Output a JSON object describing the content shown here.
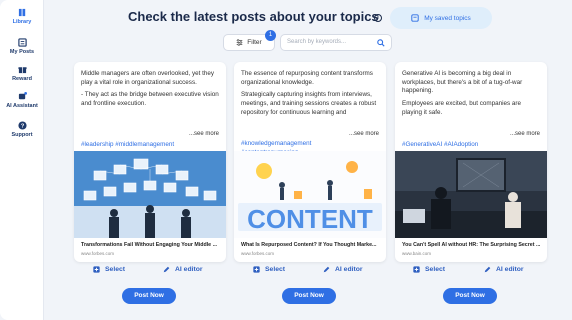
{
  "sidebar": {
    "items": [
      {
        "label": "Library",
        "icon": "library-icon",
        "active": true
      },
      {
        "label": "My Posts",
        "icon": "posts-icon"
      },
      {
        "label": "Reward",
        "icon": "reward-icon"
      },
      {
        "label": "AI Assistant",
        "icon": "ai-assistant-icon"
      },
      {
        "label": "Support",
        "icon": "support-icon"
      }
    ]
  },
  "header": {
    "title": "Check the latest posts about your topics",
    "saved_topics_label": "My saved topics",
    "filter_label": "Filter",
    "filter_count": "1",
    "search_placeholder": "Search by keywords..."
  },
  "cards": [
    {
      "paragraphs": [
        "Middle managers are often overlooked, yet they play a vital role in organizational success.",
        "- They act as the bridge between executive vision and frontline execution."
      ],
      "see_more": "...see more",
      "tags": "#leadership #middlemanagement",
      "link_title": "Transformations Fail Without Engaging Your Middle ...",
      "domain": "www.forbes.com",
      "select_label": "Select",
      "editor_label": "AI editor",
      "post_label": "Post Now"
    },
    {
      "paragraphs": [
        "The essence of repurposing content transforms organizational knowledge.",
        "Strategically capturing insights from interviews, meetings, and training sessions creates a robust repository for continuous learning and"
      ],
      "see_more": "...see more",
      "tags": "#knowledgemanagement\n#contentrepurposing",
      "link_title": "What Is Repurposed Content? If You Thought Marke...",
      "domain": "www.forbes.com",
      "select_label": "Select",
      "editor_label": "AI editor",
      "post_label": "Post Now"
    },
    {
      "paragraphs": [
        "Generative AI is becoming a big deal in workplaces, but there's a bit of a tug-of-war happening.",
        "Employees are excited, but companies are playing it safe."
      ],
      "see_more": "...see more",
      "tags": "#GenerativeAI #AIAdoption",
      "link_title": "You Can't Spell AI without HR: The Surprising Secret ...",
      "domain": "www.bain.com",
      "select_label": "Select",
      "editor_label": "AI editor",
      "post_label": "Post Now"
    }
  ],
  "colors": {
    "accent": "#2f6fe4",
    "title": "#1b2a4a",
    "background": "#f1f4f9"
  }
}
